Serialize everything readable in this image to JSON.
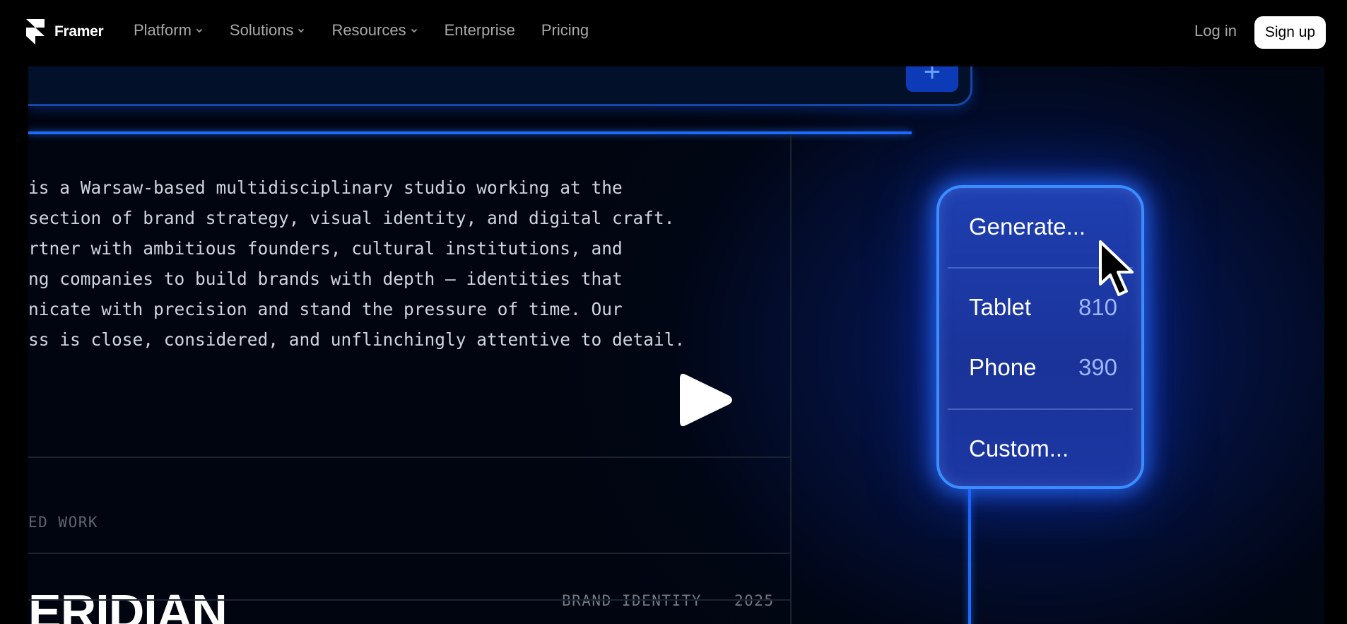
{
  "nav": {
    "brand": "Framer",
    "menu": [
      {
        "label": "Platform",
        "has_dropdown": true
      },
      {
        "label": "Solutions",
        "has_dropdown": true
      },
      {
        "label": "Resources",
        "has_dropdown": true
      },
      {
        "label": "Enterprise",
        "has_dropdown": false
      },
      {
        "label": "Pricing",
        "has_dropdown": false
      }
    ],
    "login": "Log in",
    "signup": "Sign up"
  },
  "video": {
    "plus_icon": "+",
    "paragraph_lines": [
      "is a Warsaw-based multidisciplinary studio working at the",
      "section of brand strategy, visual identity, and digital craft.",
      "rtner with ambitious founders, cultural institutions, and",
      "ng companies to build brands with depth — identities that",
      "nicate with precision and stand the pressure of time. Our",
      "ss is close, considered, and unflinchingly attentive to detail."
    ],
    "section_label": "ED WORK",
    "project": {
      "title": "ERIDIAN",
      "category": "BRAND IDENTITY",
      "year": "2025"
    },
    "popup": {
      "generate": "Generate...",
      "tablet_label": "Tablet",
      "tablet_value": "810",
      "phone_label": "Phone",
      "phone_value": "390",
      "custom": "Custom..."
    }
  },
  "icons": {
    "logo": "framer-logo-icon",
    "dropdown": "chevron-down-icon",
    "play": "play-icon",
    "cursor": "cursor-arrow-icon",
    "plus": "plus-icon"
  },
  "colors": {
    "accent_blue": "#1d6bff",
    "popup_bg": "#1e3fb0",
    "nav_bg": "#000000"
  }
}
